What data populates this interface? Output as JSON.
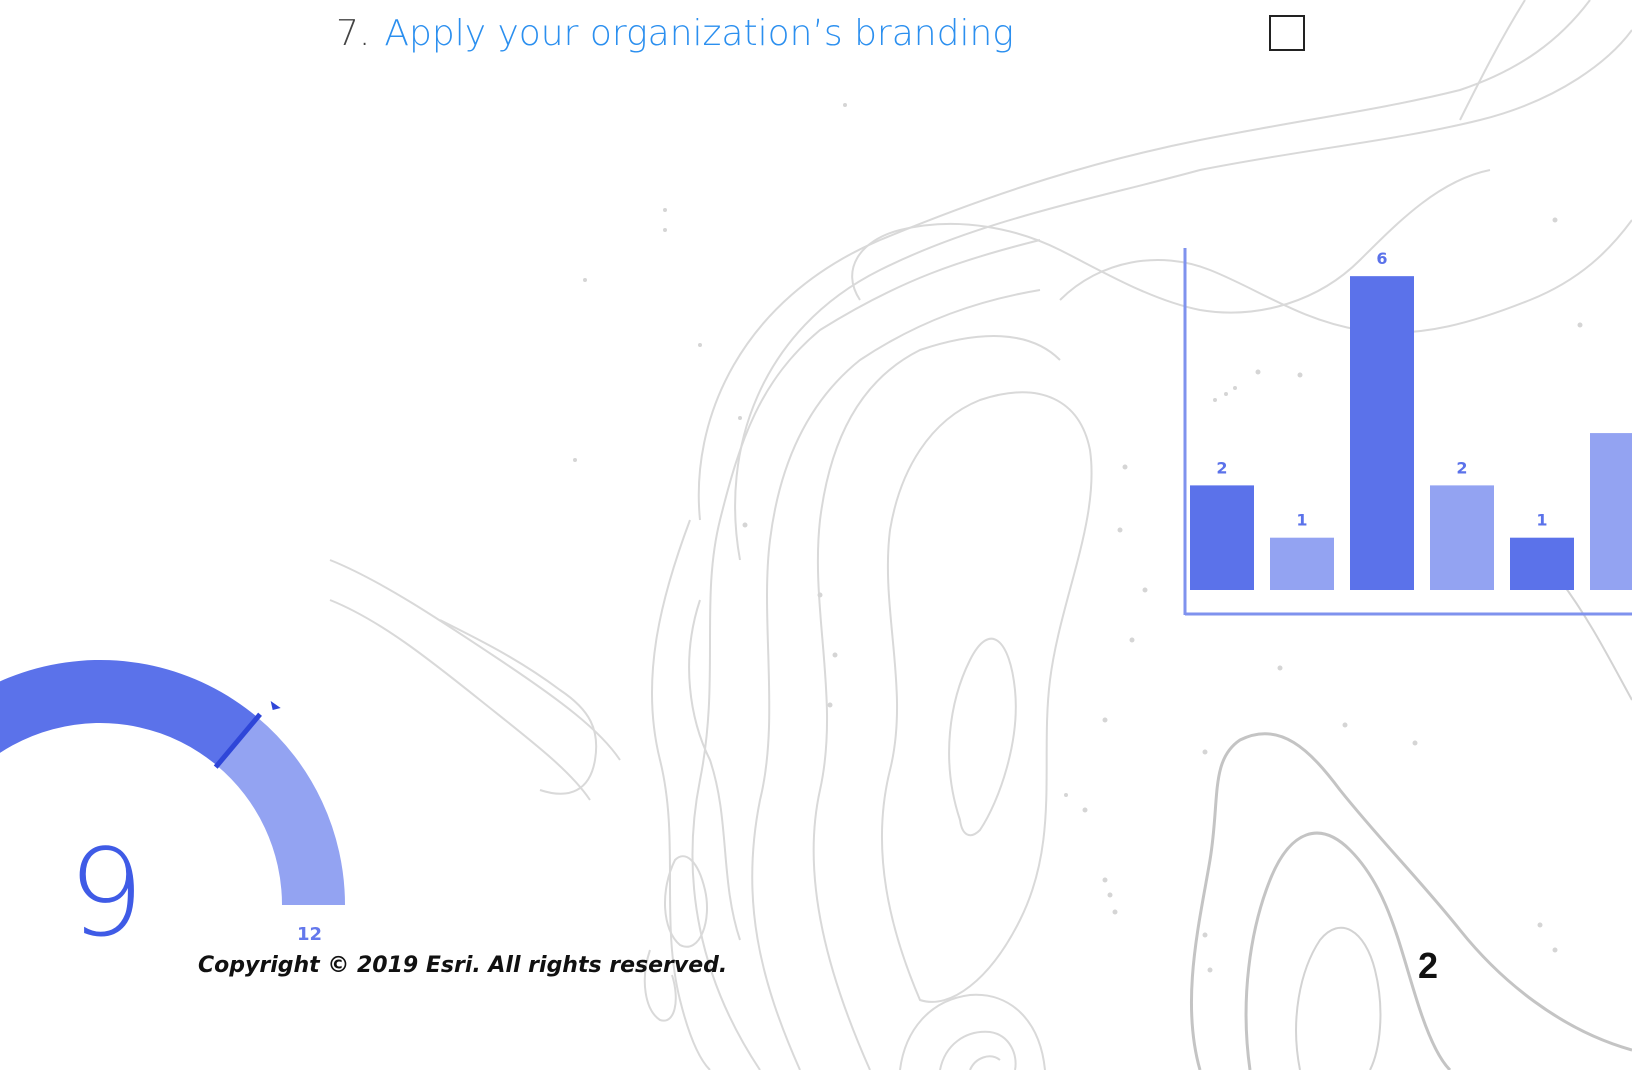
{
  "checklist_item": {
    "number": "7.",
    "link_text": "Apply your organization’s branding",
    "checked": false
  },
  "decorative_bar_chart": {
    "type": "bar",
    "categories": [
      "",
      "",
      "",
      "",
      "",
      ""
    ],
    "values": [
      2,
      1,
      6,
      2,
      1,
      3
    ],
    "value_labels": [
      "2",
      "1",
      "6",
      "2",
      "1",
      ""
    ],
    "ylim": [
      0,
      6.5
    ],
    "colors": [
      "#5b72ea",
      "#93a3f2",
      "#5b72ea",
      "#93a3f2",
      "#5b72ea",
      "#93a3f2"
    ]
  },
  "decorative_gauge": {
    "value_label": "9",
    "max_label": "12",
    "value": 9,
    "max": 12,
    "colors": {
      "filled": "#5b72ea",
      "remaining": "#93a3f2",
      "needle": "#2f46d8"
    }
  },
  "footer": {
    "copyright": "Copyright © 2019 Esri. All rights reserved.",
    "page_number": "2"
  },
  "colors": {
    "link": "#2b8fef",
    "contour": "#d7d7d7",
    "contour_dark": "#bdbdbd",
    "chart_axis": "#7f92ee"
  }
}
